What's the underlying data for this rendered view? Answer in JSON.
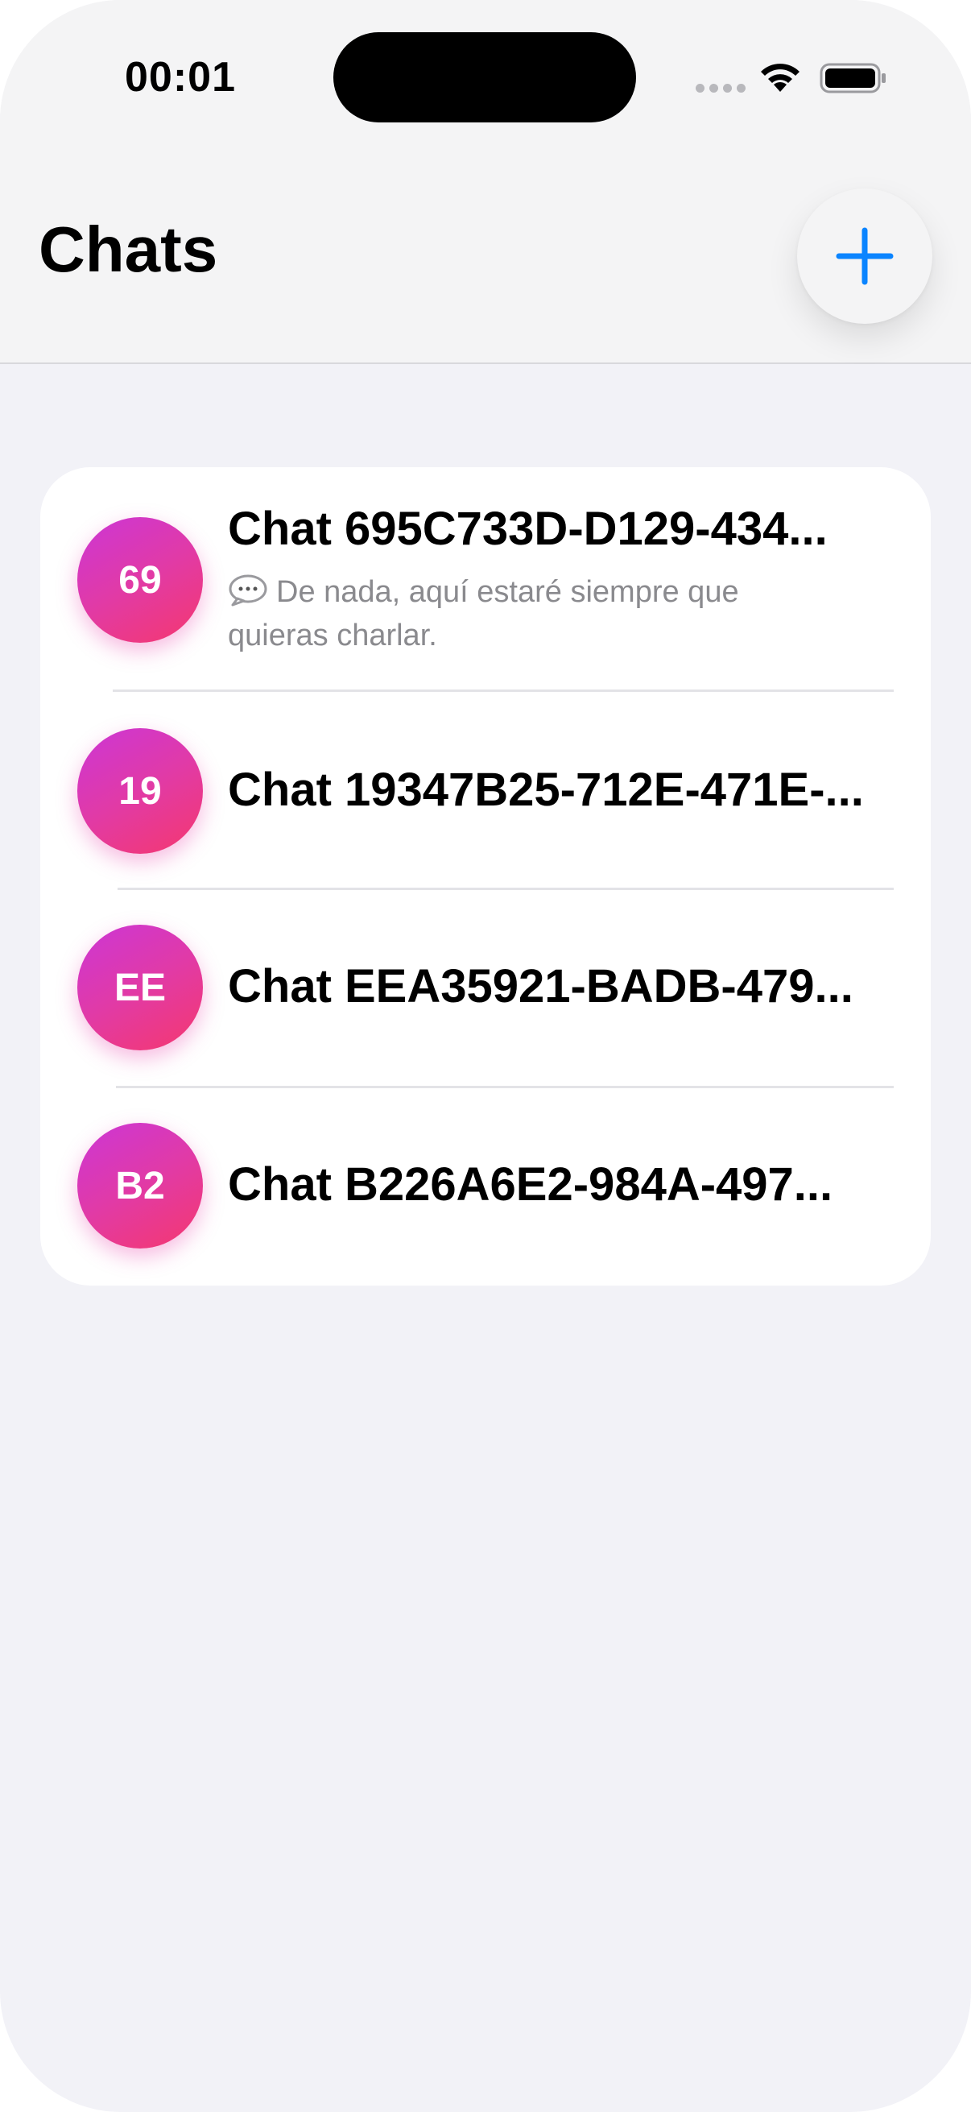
{
  "status_bar": {
    "time": "00:01"
  },
  "header": {
    "title": "Chats",
    "add_icon": "plus-icon"
  },
  "colors": {
    "accent": "#0a84ff",
    "avatar_gradient_start": "#cc36d6",
    "avatar_gradient_end": "#f5386e",
    "background": "#f2f2f7"
  },
  "chats": [
    {
      "initials": "69",
      "title": "Chat 695C733D-D129-434...",
      "preview": "De nada, aquí estaré siempre que quieras charlar.",
      "preview_icon": "speech-bubble-icon"
    },
    {
      "initials": "19",
      "title": "Chat 19347B25-712E-471E-..."
    },
    {
      "initials": "EE",
      "title": "Chat EEA35921-BADB-479..."
    },
    {
      "initials": "B2",
      "title": "Chat B226A6E2-984A-497..."
    }
  ]
}
